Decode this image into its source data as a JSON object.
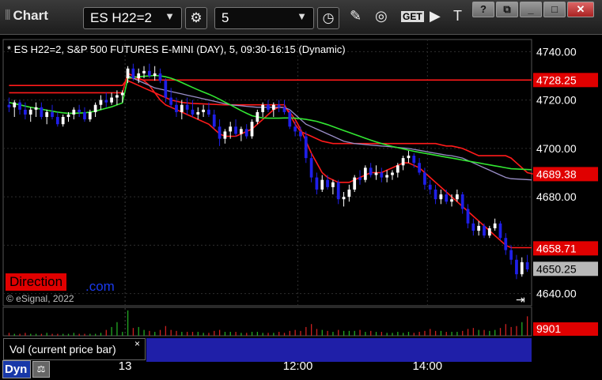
{
  "toolbar": {
    "app_title": "Chart",
    "symbol": "ES H22=2",
    "interval": "5",
    "dropdown_glyph": "▼",
    "icons": [
      "settings-icon",
      "clock-icon",
      "draw-pen-icon",
      "study-icon",
      "get-icon",
      "play-icon",
      "text-tool-icon"
    ],
    "window_buttons": [
      "help-icon",
      "restore-icon",
      "minimize-icon",
      "maximize-icon",
      "close-icon"
    ]
  },
  "chart_header": "* ES H22=2, S&P 500 FUTURES E-MINI (DAY), 5, 09:30-16:15 (Dynamic)",
  "copyright": "© eSignal, 2022",
  "watermark": {
    "direction": "Direction",
    "com": ".com"
  },
  "volume_panel": {
    "label": "Vol (current price bar)",
    "close_glyph": "×"
  },
  "bottom_bar": {
    "dyn_label": "Dyn"
  },
  "colors": {
    "up": "#ffffff",
    "down": "#1f1fe8",
    "red_line": "#ff1a1a",
    "green_line": "#32e632",
    "purple_line": "#9a8ec8",
    "price_flag_red": "#e00000",
    "last_flag": "#b8b8b8",
    "volume_up": "#22a822",
    "volume_down": "#cc2020"
  },
  "chart_data": {
    "type": "candlestick",
    "ylim": [
      4635,
      4745
    ],
    "y_ticks": [
      "4740.00",
      "4720.00",
      "4700.00",
      "4680.00",
      "4660.00",
      "4640.00"
    ],
    "x_ticks": [
      "13",
      "12:00",
      "14:00"
    ],
    "price_flags": [
      {
        "label": "4728.25",
        "value": 4728.25,
        "style": "red"
      },
      {
        "label": "4689.38",
        "value": 4689.38,
        "style": "red"
      },
      {
        "label": "4658.71",
        "value": 4658.71,
        "style": "red"
      },
      {
        "label": "4650.25",
        "value": 4650.25,
        "style": "last"
      }
    ],
    "volume_flag": "9901",
    "candles": [
      [
        4718,
        4721,
        4715,
        4717
      ],
      [
        4717,
        4720,
        4713,
        4719
      ],
      [
        4719,
        4720,
        4714,
        4716
      ],
      [
        4716,
        4719,
        4712,
        4714
      ],
      [
        4714,
        4717,
        4711,
        4716
      ],
      [
        4716,
        4719,
        4713,
        4717
      ],
      [
        4717,
        4719,
        4712,
        4713
      ],
      [
        4713,
        4716,
        4710,
        4715
      ],
      [
        4715,
        4718,
        4712,
        4713
      ],
      [
        4713,
        4715,
        4709,
        4710
      ],
      [
        4710,
        4714,
        4709,
        4713
      ],
      [
        4713,
        4715,
        4711,
        4714
      ],
      [
        4714,
        4717,
        4712,
        4716
      ],
      [
        4716,
        4718,
        4713,
        4715
      ],
      [
        4715,
        4717,
        4711,
        4712
      ],
      [
        4712,
        4716,
        4711,
        4715
      ],
      [
        4715,
        4719,
        4713,
        4718
      ],
      [
        4718,
        4722,
        4716,
        4720
      ],
      [
        4720,
        4723,
        4717,
        4719
      ],
      [
        4719,
        4723,
        4718,
        4721
      ],
      [
        4721,
        4724,
        4718,
        4722
      ],
      [
        4722,
        4724,
        4719,
        4723
      ],
      [
        4729,
        4734,
        4727,
        4733
      ],
      [
        4733,
        4735,
        4728,
        4729
      ],
      [
        4729,
        4733,
        4727,
        4731
      ],
      [
        4731,
        4734,
        4729,
        4732
      ],
      [
        4732,
        4735,
        4729,
        4730
      ],
      [
        4730,
        4734,
        4728,
        4731
      ],
      [
        4731,
        4733,
        4727,
        4728
      ],
      [
        4728,
        4729,
        4719,
        4721
      ],
      [
        4721,
        4725,
        4717,
        4718
      ],
      [
        4718,
        4721,
        4713,
        4715
      ],
      [
        4715,
        4720,
        4712,
        4718
      ],
      [
        4718,
        4721,
        4714,
        4716
      ],
      [
        4716,
        4720,
        4713,
        4714
      ],
      [
        4714,
        4717,
        4712,
        4715
      ],
      [
        4715,
        4718,
        4713,
        4716
      ],
      [
        4716,
        4719,
        4713,
        4714
      ],
      [
        4714,
        4716,
        4708,
        4709
      ],
      [
        4709,
        4712,
        4701,
        4704
      ],
      [
        4704,
        4708,
        4702,
        4707
      ],
      [
        4707,
        4711,
        4704,
        4709
      ],
      [
        4709,
        4712,
        4705,
        4706
      ],
      [
        4706,
        4709,
        4703,
        4708
      ],
      [
        4708,
        4710,
        4704,
        4705
      ],
      [
        4705,
        4712,
        4704,
        4711
      ],
      [
        4711,
        4716,
        4710,
        4715
      ],
      [
        4715,
        4719,
        4713,
        4718
      ],
      [
        4718,
        4720,
        4715,
        4716
      ],
      [
        4716,
        4719,
        4713,
        4718
      ],
      [
        4718,
        4720,
        4715,
        4717
      ],
      [
        4717,
        4720,
        4714,
        4715
      ],
      [
        4715,
        4716,
        4708,
        4709
      ],
      [
        4709,
        4711,
        4705,
        4707
      ],
      [
        4707,
        4709,
        4703,
        4705
      ],
      [
        4705,
        4707,
        4694,
        4696
      ],
      [
        4696,
        4698,
        4686,
        4688
      ],
      [
        4688,
        4690,
        4681,
        4683
      ],
      [
        4683,
        4689,
        4682,
        4687
      ],
      [
        4687,
        4689,
        4683,
        4684
      ],
      [
        4684,
        4687,
        4681,
        4686
      ],
      [
        4686,
        4687,
        4677,
        4679
      ],
      [
        4679,
        4682,
        4676,
        4680
      ],
      [
        4680,
        4685,
        4678,
        4683
      ],
      [
        4683,
        4689,
        4682,
        4688
      ],
      [
        4688,
        4691,
        4685,
        4687
      ],
      [
        4687,
        4693,
        4686,
        4692
      ],
      [
        4692,
        4694,
        4688,
        4689
      ],
      [
        4689,
        4693,
        4687,
        4690
      ],
      [
        4690,
        4692,
        4686,
        4688
      ],
      [
        4688,
        4691,
        4686,
        4689
      ],
      [
        4689,
        4691,
        4687,
        4690
      ],
      [
        4690,
        4694,
        4688,
        4693
      ],
      [
        4693,
        4697,
        4691,
        4696
      ],
      [
        4696,
        4699,
        4694,
        4697
      ],
      [
        4697,
        4698,
        4692,
        4694
      ],
      [
        4694,
        4696,
        4689,
        4690
      ],
      [
        4690,
        4692,
        4683,
        4685
      ],
      [
        4685,
        4687,
        4681,
        4683
      ],
      [
        4683,
        4685,
        4677,
        4679
      ],
      [
        4679,
        4683,
        4677,
        4681
      ],
      [
        4681,
        4683,
        4677,
        4678
      ],
      [
        4678,
        4681,
        4676,
        4679
      ],
      [
        4679,
        4683,
        4678,
        4681
      ],
      [
        4681,
        4682,
        4673,
        4675
      ],
      [
        4675,
        4677,
        4667,
        4669
      ],
      [
        4669,
        4671,
        4664,
        4666
      ],
      [
        4666,
        4670,
        4664,
        4668
      ],
      [
        4668,
        4669,
        4663,
        4664
      ],
      [
        4664,
        4668,
        4663,
        4667
      ],
      [
        4667,
        4671,
        4666,
        4669
      ],
      [
        4669,
        4670,
        4662,
        4663
      ],
      [
        4663,
        4665,
        4656,
        4658
      ],
      [
        4658,
        4660,
        4652,
        4654
      ],
      [
        4654,
        4656,
        4646,
        4648
      ],
      [
        4648,
        4655,
        4647,
        4653
      ],
      [
        4653,
        4656,
        4649,
        4650
      ]
    ],
    "volume": [
      3,
      2,
      2,
      3,
      2,
      2,
      2,
      3,
      2,
      2,
      2,
      2,
      3,
      2,
      2,
      2,
      2,
      3,
      6,
      9,
      14,
      4,
      26,
      8,
      9,
      6,
      5,
      4,
      6,
      10,
      6,
      5,
      4,
      4,
      4,
      4,
      3,
      3,
      5,
      6,
      4,
      4,
      4,
      3,
      3,
      4,
      4,
      3,
      3,
      3,
      4,
      3,
      5,
      6,
      5,
      9,
      12,
      7,
      6,
      5,
      4,
      6,
      5,
      5,
      5,
      6,
      4,
      5,
      4,
      4,
      3,
      3,
      4,
      3,
      4,
      3,
      4,
      5,
      7,
      5,
      5,
      4,
      4,
      4,
      5,
      7,
      8,
      6,
      6,
      5,
      6,
      8,
      12,
      9,
      10,
      14,
      20
    ],
    "series": [
      {
        "style": "red",
        "values": [
          4723,
          4723,
          4723,
          4723,
          4723,
          4723,
          4723,
          4723,
          4723,
          4723,
          4723,
          4723,
          4723,
          4723,
          4723,
          4723,
          4723,
          4723,
          4723,
          4723,
          4723,
          4723,
          4731,
          4730,
          4729,
          4728,
          4726,
          4723,
          4720,
          4718,
          4717,
          4716,
          4715,
          4714,
          4713,
          4712,
          4711,
          4710,
          4708,
          4706,
          4705,
          4705,
          4705,
          4706,
          4707,
          4708,
          4710,
          4712,
          4714,
          4716,
          4717,
          4717,
          4715,
          4712,
          4708,
          4703,
          4698,
          4694,
          4690,
          4688,
          4687,
          4686,
          4686,
          4686,
          4687,
          4688,
          4689,
          4690,
          4690,
          4690,
          4691,
          4692,
          4693,
          4694,
          4694,
          4693,
          4692,
          4690,
          4688,
          4686,
          4684,
          4682,
          4680,
          4678,
          4676,
          4674,
          4672,
          4670,
          4668,
          4666,
          4664,
          4662,
          4660,
          4659,
          4659
        ]
      },
      {
        "style": "red",
        "values": [
          4726,
          4726,
          4726,
          4726,
          4726,
          4726,
          4726,
          4726,
          4726,
          4726,
          4726,
          4726,
          4726,
          4726,
          4726,
          4726,
          4726,
          4726,
          4726,
          4726,
          4726,
          4726,
          4729,
          4729,
          4728.5,
          4728.3,
          4728.25,
          4728.25,
          4728.25,
          4728.25,
          4728.25,
          4728.25,
          4728.25,
          4728.25,
          4728.25,
          4728.25,
          4728.25,
          4728.25,
          4728.25,
          4728.25,
          4728.25,
          4728.25,
          4728.25,
          4728.25,
          4728.25,
          4728.25,
          4728.25,
          4728.25,
          4728.25,
          4728.25,
          4728.25,
          4728.25,
          4728.25,
          4728.25,
          4728.25,
          4728.25,
          4728.25,
          4728.25,
          4728.25,
          4728.25,
          4728.25,
          4728.25,
          4728.25,
          4728.25,
          4728.25,
          4728.25,
          4728.25,
          4728.25,
          4728.25,
          4728.25,
          4728.25,
          4728.25,
          4728.25,
          4728.25,
          4728.25,
          4728.25,
          4728.25,
          4728.25,
          4728.25,
          4728.25,
          4728.25,
          4728.25,
          4728.25,
          4728.25,
          4728.25,
          4728.25,
          4728.25,
          4728.25,
          4728.25,
          4728.25,
          4728.25,
          4728.25,
          4728.25,
          4728.25,
          4728.25
        ]
      },
      {
        "style": "red",
        "values": [
          null,
          null,
          null,
          null,
          null,
          null,
          null,
          null,
          null,
          null,
          null,
          null,
          null,
          null,
          null,
          null,
          null,
          null,
          null,
          null,
          null,
          null,
          4728,
          4727,
          4726,
          4725,
          4724,
          4723,
          4722,
          4721,
          4720,
          4719.5,
          4719,
          4718.8,
          4718.6,
          4718.5,
          4718.4,
          4718.3,
          4718.2,
          4718.1,
          4718,
          4718,
          4718,
          4718,
          4718,
          4718,
          4718,
          4718,
          4718,
          4718,
          4718,
          4718,
          4714,
          4710,
          4707,
          4706,
          4705,
          4704,
          4703,
          4702.5,
          4702,
          4702,
          4702,
          4702,
          4702,
          4702,
          4702,
          4702,
          4702,
          4702,
          4702,
          4702,
          4702,
          4702,
          4702,
          4702,
          4702,
          4702,
          4702,
          4702,
          4701.5,
          4701,
          4701,
          4700.5,
          4700,
          4699,
          4698,
          4697,
          4697,
          4697,
          4697,
          4697,
          4697,
          4696,
          4694,
          4692,
          4690,
          4689.5,
          4689.38
        ]
      },
      {
        "style": "purple",
        "values": [
          null,
          null,
          null,
          null,
          null,
          null,
          null,
          null,
          null,
          null,
          null,
          null,
          null,
          null,
          null,
          null,
          null,
          null,
          null,
          null,
          null,
          null,
          4730,
          4729,
          4728,
          4727,
          4726,
          4725,
          4724.5,
          4724,
          4723.5,
          4723,
          4722.5,
          4722,
          4721.5,
          4721,
          4720.5,
          4720,
          4719.5,
          4719,
          4718.5,
          4718,
          4717.8,
          4717.6,
          4717.4,
          4717.2,
          4717,
          4717,
          4717,
          4717,
          4717,
          4716.9,
          4716,
          4714,
          4712,
          4710,
          4709,
          4708,
          4707,
          4706,
          4705,
          4704,
          4703,
          4702.5,
          4702,
          4701.8,
          4701.6,
          4701.4,
          4701.2,
          4701,
          4700.8,
          4700.6,
          4700.4,
          4700.2,
          4700,
          4699.6,
          4699.2,
          4698.8,
          4698.4,
          4698,
          4697.6,
          4697.2,
          4697,
          4696.5,
          4696,
          4695,
          4694,
          4693,
          4692,
          4691,
          4690,
          4689,
          4688,
          4687.5,
          4687
        ]
      },
      {
        "style": "green",
        "values": [
          4719,
          4718.5,
          4718,
          4717.5,
          4717,
          4716.6,
          4716.2,
          4715.8,
          4715.4,
          4715,
          4714.7,
          4714.5,
          4714.5,
          4714.6,
          4714.7,
          4715,
          4715.4,
          4716,
          4716.6,
          4717.2,
          4718,
          4718.8,
          4729,
          4729.4,
          4729.6,
          4729.8,
          4730,
          4730.1,
          4730,
          4729.6,
          4729,
          4728.2,
          4727.2,
          4726.2,
          4725.2,
          4724.2,
          4723.3,
          4722.4,
          4721.4,
          4720.3,
          4719.1,
          4718,
          4716.8,
          4715.6,
          4714.5,
          4713.5,
          4713,
          4712.6,
          4712.5,
          4712.5,
          4712.5,
          4712.6,
          4712.6,
          4712.5,
          4712.3,
          4712,
          4711.6,
          4711.2,
          4710.5,
          4709.8,
          4709.0,
          4708.2,
          4707.4,
          4706.6,
          4705.8,
          4705,
          4704.2,
          4703.4,
          4702.7,
          4702,
          4701.4,
          4700.8,
          4700.3,
          4699.8,
          4699.3,
          4698.8,
          4698.4,
          4698,
          4697.6,
          4697.2,
          4696.8,
          4696.4,
          4696,
          4695.6,
          4695.2,
          4694.8,
          4694.4,
          4694,
          4693.6,
          4693.2,
          4692.8,
          4692.4,
          4692,
          4691.6,
          4691.2
        ]
      }
    ]
  }
}
